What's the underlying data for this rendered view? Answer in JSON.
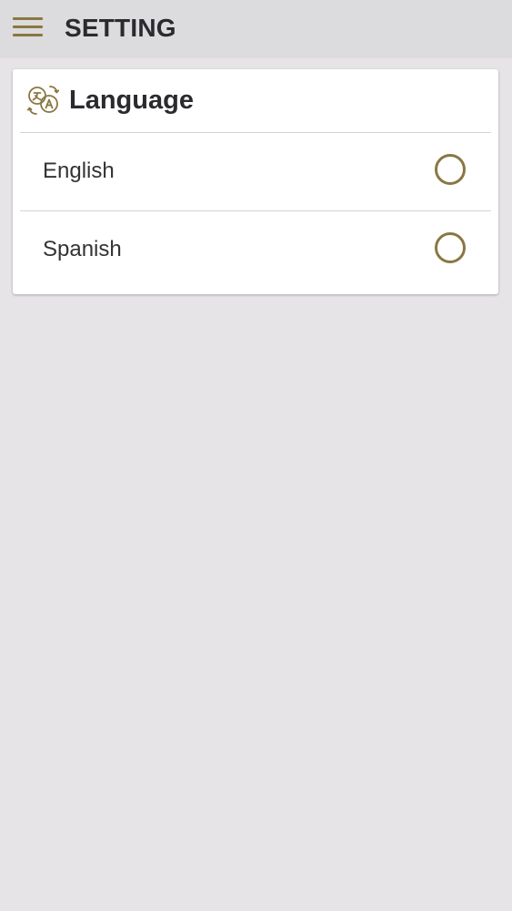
{
  "appbar": {
    "title": "SETTING",
    "menu_icon": "hamburger-menu-icon"
  },
  "language_card": {
    "title": "Language",
    "icon": "translate-icon",
    "options": [
      {
        "label": "English",
        "selected": false
      },
      {
        "label": "Spanish",
        "selected": false
      }
    ]
  },
  "colors": {
    "accent": "#8a7744",
    "background": "#e6e4e6",
    "appbar": "#dcdbdd",
    "card": "#ffffff",
    "text": "#2b2a2e"
  }
}
